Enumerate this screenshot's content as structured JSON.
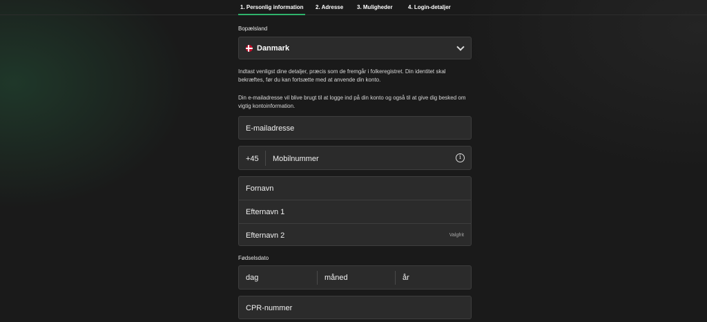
{
  "steps": [
    {
      "label": "1. Personlig information"
    },
    {
      "label": "2. Adresse"
    },
    {
      "label": "3. Muligheder"
    },
    {
      "label": "4. Login-detaljer"
    }
  ],
  "country": {
    "label": "Bopælsland",
    "value": "Danmark",
    "flag_icon": "denmark-flag-icon"
  },
  "info": {
    "identity": "Indtast venligst dine detaljer, præcis som de fremgår i folkeregistret. Din identitet skal bekræftes, før du kan fortsætte med at anvende din konto.",
    "email_notice": "Din e-mailadresse vil blive brugt til at logge ind på din konto og også til at give dig besked om vigtig kontoinformation."
  },
  "fields": {
    "email_placeholder": "E-mailadresse",
    "phone_prefix": "+45",
    "phone_placeholder": "Mobilnummer",
    "first_name_placeholder": "Fornavn",
    "last_name1_placeholder": "Efternavn 1",
    "last_name2_placeholder": "Efternavn 2",
    "optional_label": "Valgfrit",
    "cpr_placeholder": "CPR-nummer"
  },
  "dob": {
    "label": "Fødselsdato",
    "day_placeholder": "dag",
    "month_placeholder": "måned",
    "year_placeholder": "år"
  },
  "colors": {
    "accent": "#2fb36b",
    "background": "#1a1a1a",
    "field": "#2b2b2b"
  }
}
